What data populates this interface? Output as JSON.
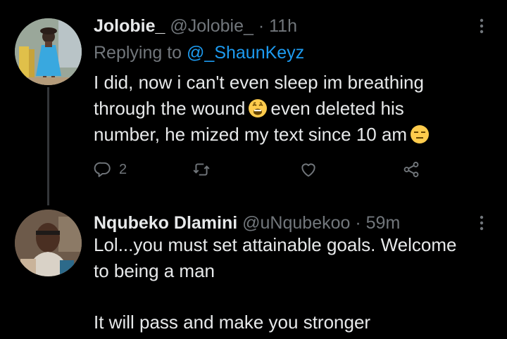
{
  "tweets": [
    {
      "display_name": "Jolobie_",
      "handle": "@Jolobie_",
      "separator": "·",
      "time": "11h",
      "replying_to_label": "Replying to",
      "replying_to_handle": "@_ShaunKeyz",
      "lines": [
        "I did, now i can't even sleep im breathing",
        "through the wound",
        "even deleted his",
        "number, he mized my text since 10 am"
      ],
      "emojis": [
        "weary-face-emoji",
        "expressionless-face-emoji"
      ],
      "actions": {
        "reply_count": "2",
        "retweet_count": "",
        "like_count": ""
      }
    },
    {
      "display_name": "Nqubeko Dlamini",
      "handle": "@uNqubekoo",
      "separator": "·",
      "time": "59m",
      "lines": [
        "Lol...you must set attainable goals. Welcome",
        "to being a man",
        "",
        "It will pass and make you stronger"
      ]
    }
  ],
  "icons": {
    "more": "more-dots-icon",
    "reply": "reply-icon",
    "retweet": "retweet-icon",
    "like": "heart-icon",
    "share": "share-icon"
  },
  "colors": {
    "background": "#000000",
    "text": "#e7e9ea",
    "secondary": "#71767b",
    "link": "#1d9bf0",
    "thread_line": "#333639"
  }
}
